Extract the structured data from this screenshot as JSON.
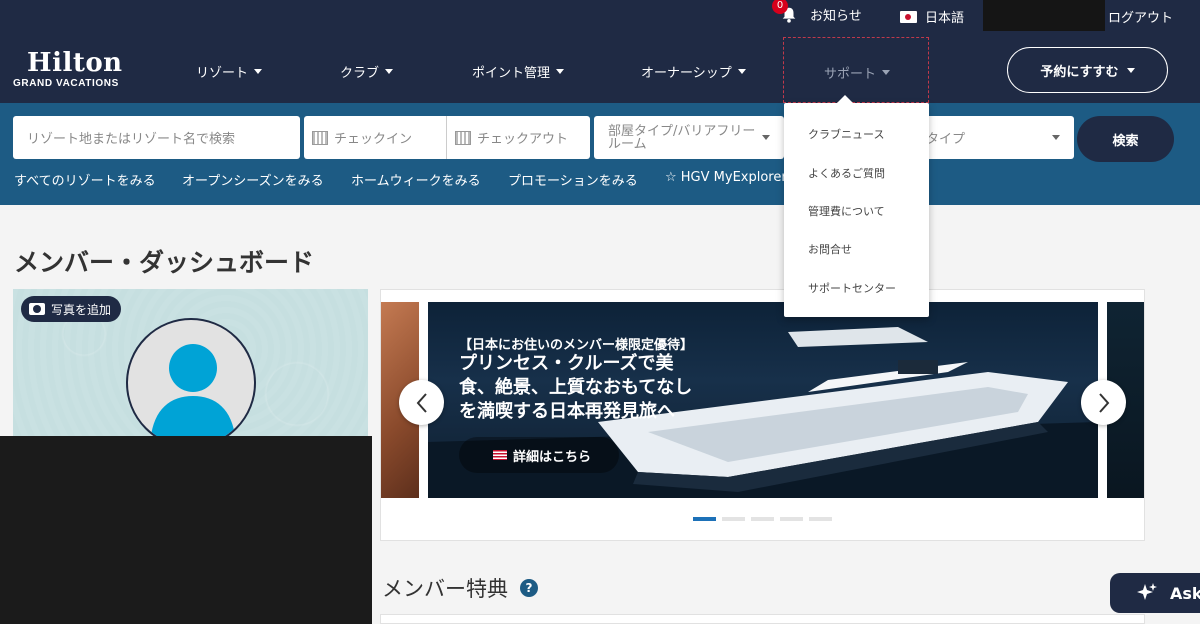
{
  "header": {
    "notification_count": "0",
    "notice_label": "お知らせ",
    "language": "日本語",
    "logout": "ログアウト",
    "logo_main": "Hilton",
    "logo_sub": "GRAND VACATIONS",
    "nav": [
      "リゾート",
      "クラブ",
      "ポイント管理",
      "オーナーシップ",
      "サポート"
    ],
    "reserve_label": "予約にすすむ"
  },
  "search": {
    "resort_placeholder": "リゾート地またはリゾート名で検索",
    "checkin_placeholder": "チェックイン",
    "checkout_placeholder": "チェックアウト",
    "room_type": "部屋タイプ/バリアフリールーム",
    "type_label": "タイプ",
    "search_button": "検索"
  },
  "quick_links": [
    "すべてのリゾートをみる",
    "オープンシーズンをみる",
    "ホームウィークをみる",
    "プロモーションをみる",
    "☆ HGV MyExplorer+"
  ],
  "support_menu": [
    "クラブニュース",
    "よくあるご質問",
    "管理費について",
    "お問合せ",
    "サポートセンター"
  ],
  "dashboard": {
    "title": "メンバー・ダッシュボード",
    "add_photo": "写真を追加"
  },
  "carousel": {
    "tag": "【日本にお住いのメンバー様限定優待】",
    "heading": "プリンセス・クルーズで美食、絶景、上質なおもてなしを満喫する日本再発見旅へ",
    "cta": "詳細はこちら",
    "slide_count": 5,
    "active_slide": 1
  },
  "benefits_title": "メンバー特典",
  "ask_label": "Ask",
  "colors": {
    "navy": "#1f2a44",
    "teal_band": "#1d5b84",
    "accent_blue": "#1d71b8",
    "badge_red": "#d6001c"
  }
}
